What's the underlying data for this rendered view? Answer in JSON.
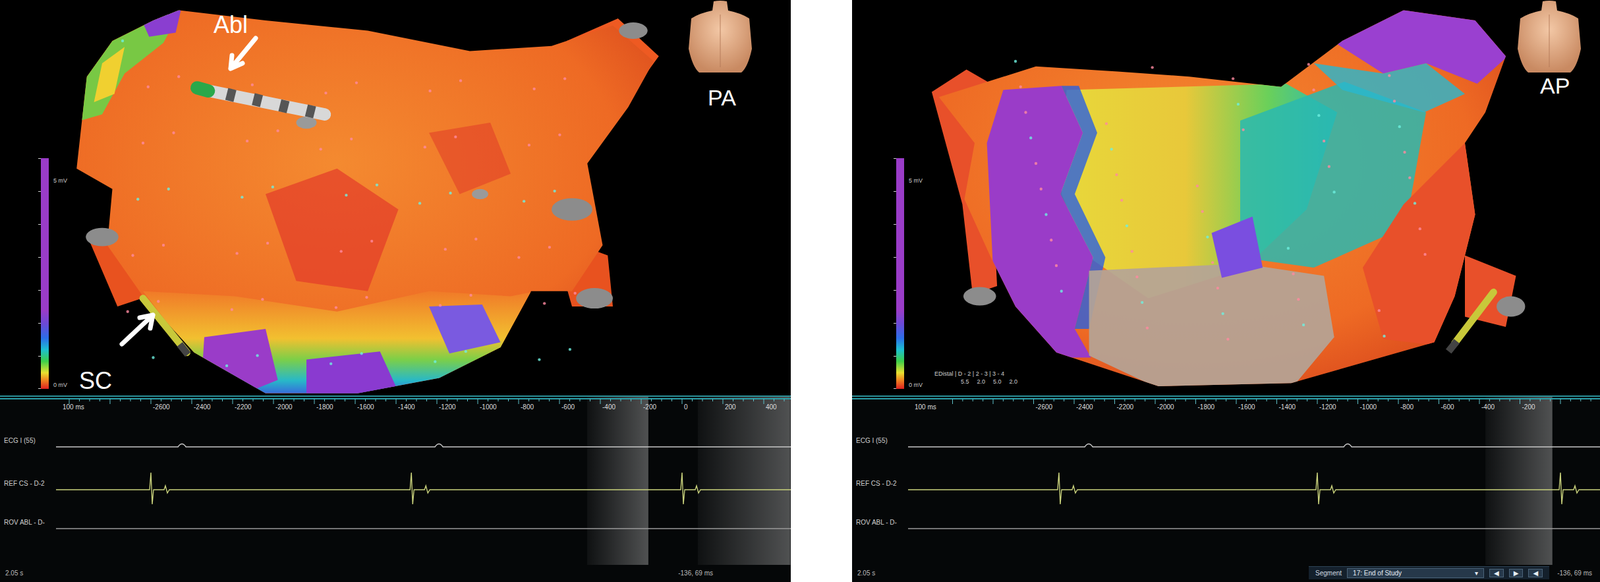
{
  "panels": [
    {
      "view": "PA",
      "scale": {
        "max": "5 mV",
        "min": "0 mV"
      },
      "callouts": [
        {
          "text": "Abl"
        },
        {
          "text": "SC"
        }
      ],
      "traces": {
        "scale_label": "100 ms",
        "ticks": [
          "-2600",
          "-2400",
          "-2200",
          "-2000",
          "-1800",
          "-1600",
          "-1400",
          "-1200",
          "-1000",
          "-800",
          "-600",
          "-400",
          "-200",
          "0",
          "200",
          "400"
        ],
        "channels": [
          {
            "name": "ECG I (55)",
            "kind": "ecg",
            "events": [
              -2448,
              -1190
            ]
          },
          {
            "name": "REF CS - D-2",
            "kind": "cs",
            "events": [
              -2600,
              -1325,
              0
            ]
          },
          {
            "name": "ROV ABL - D-",
            "kind": "flat",
            "events": []
          }
        ],
        "windows": [
          [
            -465,
            -165
          ],
          [
            77,
            530
          ]
        ],
        "footer_left": "2.05 s",
        "footer_right": "-136, 69 ms"
      }
    },
    {
      "view": "AP",
      "scale": {
        "max": "5 mV",
        "min": "0 mV"
      },
      "readout": {
        "title": "EDistal | D - 2 | 2 - 3 | 3 - 4",
        "values": [
          "5.5",
          "2.0",
          "5.0",
          "2.0"
        ]
      },
      "traces": {
        "scale_label": "100 ms",
        "ticks": [
          "-2600",
          "-2400",
          "-2200",
          "-2000",
          "-1800",
          "-1600",
          "-1400",
          "-1200",
          "-1000",
          "-800",
          "-600",
          "-400",
          "-200"
        ],
        "channels": [
          {
            "name": "ECG I (55)",
            "kind": "ecg",
            "events": [
              -2328,
              -1050
            ]
          },
          {
            "name": "REF CS - D-2",
            "kind": "cs",
            "events": [
              -2475,
              -1200,
              0
            ]
          },
          {
            "name": "ROV ABL - D-",
            "kind": "flat",
            "events": []
          }
        ],
        "windows": [
          [
            -370,
            -40
          ]
        ],
        "footer_left": "2.05 s",
        "footer_right": "-136, 69 ms",
        "toolbar": {
          "label": "Segment",
          "select": "17: End of Study",
          "arrow": "▾",
          "buttons": [
            "◀",
            "▶",
            "◀"
          ]
        }
      }
    }
  ]
}
